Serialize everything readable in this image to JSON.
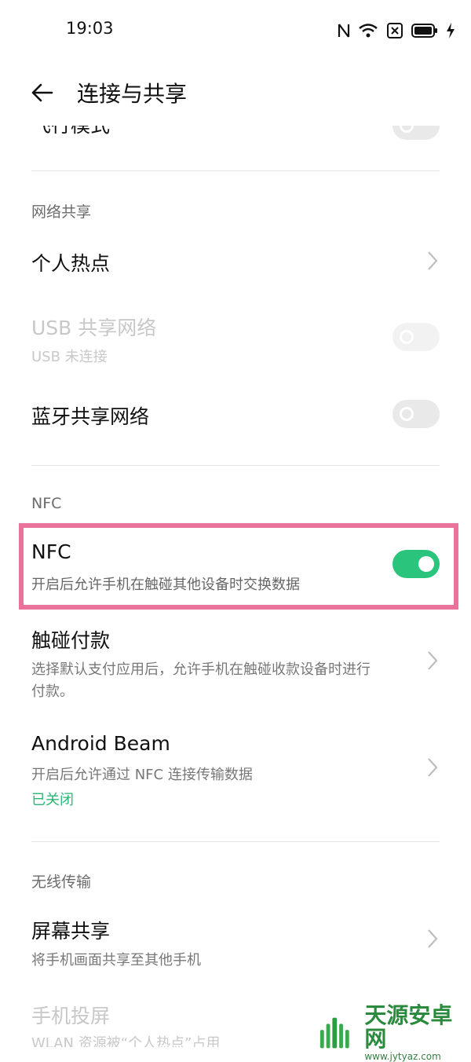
{
  "status": {
    "time": "19:03"
  },
  "header": {
    "title": "连接与共享"
  },
  "top_partial": {
    "label": "飞行模式"
  },
  "sections": {
    "network_share": "网络共享",
    "nfc": "NFC",
    "wireless": "无线传输"
  },
  "rows": {
    "hotspot": {
      "title": "个人热点"
    },
    "usb": {
      "title": "USB 共享网络",
      "subtitle": "USB 未连接"
    },
    "bluetooth": {
      "title": "蓝牙共享网络"
    },
    "nfc": {
      "title": "NFC",
      "subtitle": "开启后允许手机在触碰其他设备时交换数据",
      "enabled": true
    },
    "tap_pay": {
      "title": "触碰付款",
      "subtitle_line1": "选择默认支付应用后，允许手机在触碰收款设备时进行",
      "subtitle_line2": "付款。"
    },
    "android_beam": {
      "title": "Android Beam",
      "subtitle": "开启后允许通过 NFC 连接传输数据",
      "status": "已关闭"
    },
    "screen_share": {
      "title": "屏幕共享",
      "subtitle": "将手机画面共享至其他手机"
    },
    "cast": {
      "title": "手机投屏",
      "subtitle": "WLAN 资源被“个人热点”占用"
    }
  },
  "watermark": {
    "name": "天源安卓网",
    "url": "www.jytyaz.com"
  },
  "colors": {
    "accent_green": "#2bc47d",
    "highlight_pink": "#e9739b"
  }
}
